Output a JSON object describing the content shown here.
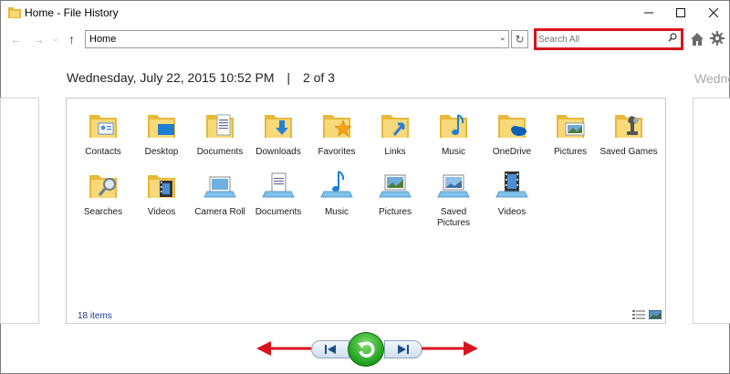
{
  "window": {
    "title": "Home - File History"
  },
  "navbar": {
    "address": "Home",
    "search_placeholder": "Search All"
  },
  "snapshot": {
    "date": "Wednesday, July 22, 2015 10:52 PM",
    "separator": "|",
    "position": "2 of 3",
    "ghost_next_date": "Wedne"
  },
  "items": [
    {
      "label": "Contacts",
      "icon": "contacts-folder-icon"
    },
    {
      "label": "Desktop",
      "icon": "desktop-folder-icon"
    },
    {
      "label": "Documents",
      "icon": "documents-folder-icon"
    },
    {
      "label": "Downloads",
      "icon": "downloads-folder-icon"
    },
    {
      "label": "Favorites",
      "icon": "favorites-folder-icon"
    },
    {
      "label": "Links",
      "icon": "links-folder-icon"
    },
    {
      "label": "Music",
      "icon": "music-folder-icon"
    },
    {
      "label": "OneDrive",
      "icon": "onedrive-folder-icon"
    },
    {
      "label": "Pictures",
      "icon": "pictures-folder-icon"
    },
    {
      "label": "Saved Games",
      "icon": "saved-games-folder-icon"
    },
    {
      "label": "Searches",
      "icon": "searches-folder-icon"
    },
    {
      "label": "Videos",
      "icon": "videos-folder-icon"
    },
    {
      "label": "Camera Roll",
      "icon": "camera-roll-library-icon"
    },
    {
      "label": "Documents",
      "icon": "documents-library-icon"
    },
    {
      "label": "Music",
      "icon": "music-library-icon"
    },
    {
      "label": "Pictures",
      "icon": "pictures-library-icon"
    },
    {
      "label": "Saved Pictures",
      "icon": "saved-pictures-library-icon"
    },
    {
      "label": "Videos",
      "icon": "videos-library-icon"
    }
  ],
  "status": {
    "count": "18 items"
  },
  "colors": {
    "accent_red": "#d8141c",
    "restore_green": "#1f9f1f",
    "folder_yellow": "#f5c94b"
  }
}
